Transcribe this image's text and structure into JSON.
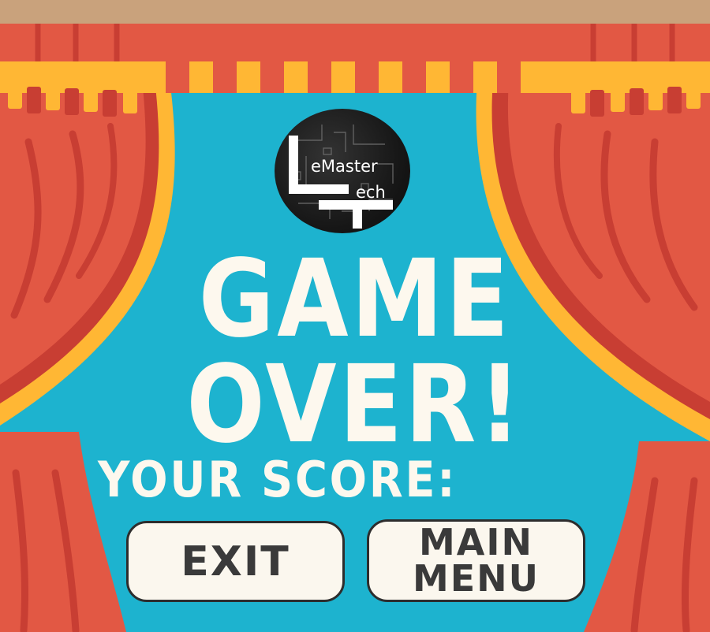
{
  "logo": {
    "line1": "eMaster",
    "line2": "ech",
    "icon": "lemaster-tech-logo"
  },
  "headline": {
    "line1": "GAME",
    "line2": "OVER!"
  },
  "score": {
    "label": "YOUR SCORE:"
  },
  "buttons": {
    "exit_label": "EXIT",
    "menu_line1": "MAIN",
    "menu_line2": "MENU"
  },
  "colors": {
    "stage_blue": "#1db3cf",
    "curtain_red": "#e25844",
    "curtain_dark": "#c83e33",
    "curtain_gold": "#ffb734",
    "top_band": "#c9a27c",
    "text_cream": "#fdf8ee",
    "button_bg": "#fbf7ee",
    "button_text": "#3a3a3a"
  }
}
